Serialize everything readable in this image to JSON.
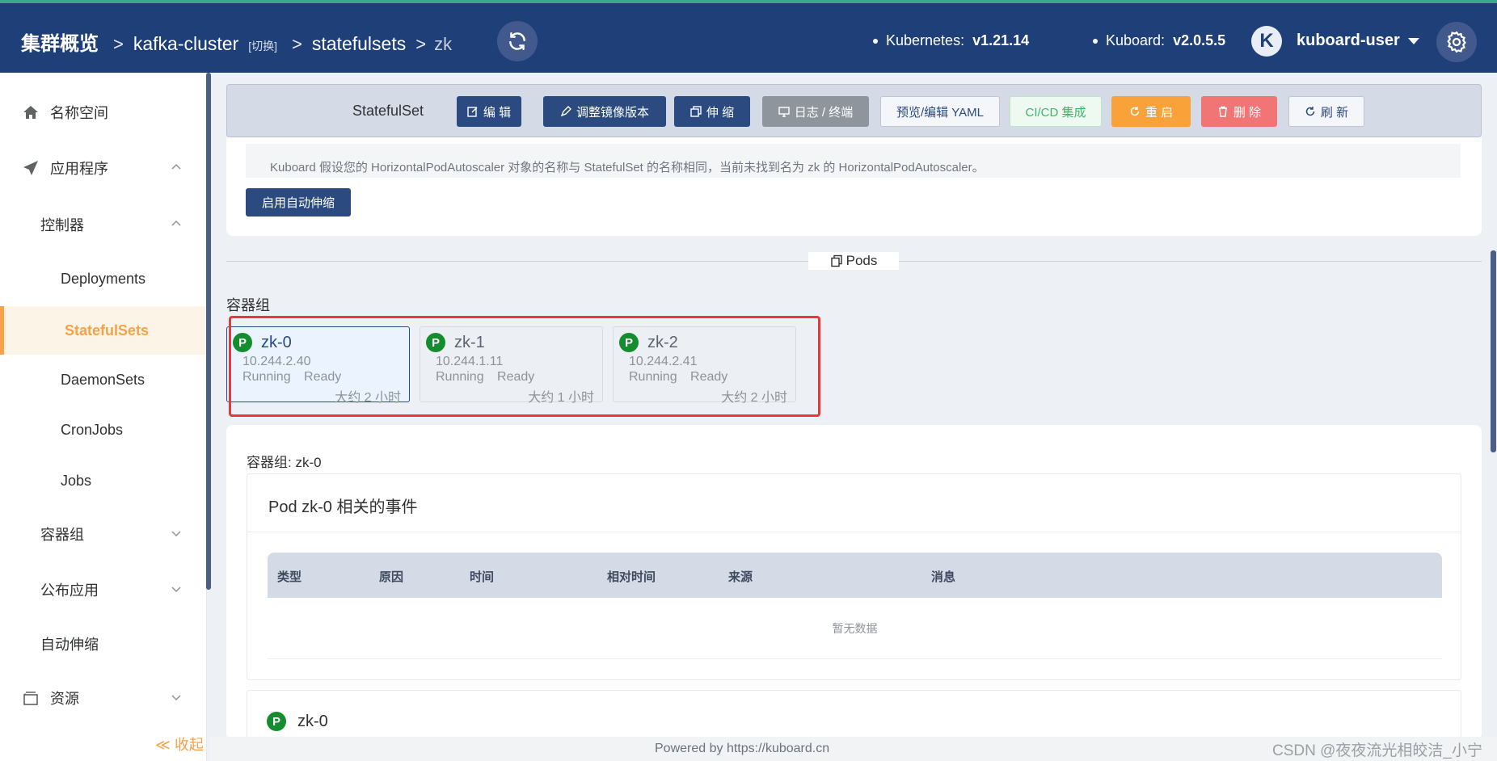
{
  "header": {
    "breadcrumb_root": "集群概览",
    "cluster": "kafka-cluster",
    "switch_label": "[切换]",
    "resource_type": "statefulsets",
    "resource_name": "zk",
    "kubernetes_label": "Kubernetes:",
    "kubernetes_version": "v1.21.14",
    "kuboard_label": "Kuboard:",
    "kuboard_version": "v2.0.5.5",
    "avatar_letter": "K",
    "username": "kuboard-user"
  },
  "sidebar": {
    "namespace": "名称空间",
    "apps": "应用程序",
    "controllers": "控制器",
    "deployments": "Deployments",
    "statefulsets": "StatefulSets",
    "daemonsets": "DaemonSets",
    "cronjobs": "CronJobs",
    "jobs": "Jobs",
    "pods": "容器组",
    "publish": "公布应用",
    "autoscale": "自动伸缩",
    "resources": "资源",
    "collapse": "≪ 收起"
  },
  "actionbar": {
    "label": "StatefulSet",
    "edit": "编 辑",
    "adjust_image": "调整镜像版本",
    "scale": "伸 缩",
    "logs": "日志 / 终端",
    "yaml": "预览/编辑 YAML",
    "cicd": "CI/CD 集成",
    "restart": "重 启",
    "delete": "删 除",
    "refresh": "刷 新"
  },
  "hpa": {
    "message": "Kuboard 假设您的 HorizontalPodAutoscaler 对象的名称与 StatefulSet 的名称相同，当前未找到名为 zk 的 HorizontalPodAutoscaler。",
    "button": "启用自动伸缩"
  },
  "pods_divider": "Pods",
  "group_title": "容器组",
  "pods": [
    {
      "badge": "P",
      "name": "zk-0",
      "ip": "10.244.2.40",
      "status": "Running Ready",
      "age": "大约 2 小时"
    },
    {
      "badge": "P",
      "name": "zk-1",
      "ip": "10.244.1.11",
      "status": "Running Ready",
      "age": "大约 1 小时"
    },
    {
      "badge": "P",
      "name": "zk-2",
      "ip": "10.244.2.41",
      "status": "Running Ready",
      "age": "大约 2 小时"
    }
  ],
  "detail": {
    "title": "容器组: zk-0",
    "events_title": "Pod zk-0 相关的事件",
    "columns": [
      "类型",
      "原因",
      "时间",
      "相对时间",
      "来源",
      "消息"
    ],
    "empty": "暂无数据",
    "pod_badge": "P",
    "pod_name": "zk-0"
  },
  "footer": {
    "powered": "Powered by https://kuboard.cn",
    "watermark": "CSDN @夜夜流光相皎洁_小宁"
  },
  "colors": {
    "header_bg": "#1f3f78",
    "accent_orange": "#f5a24a",
    "primary_button": "#2b4b80",
    "running_green": "#138d2e",
    "highlight_red": "#e63a3a"
  }
}
